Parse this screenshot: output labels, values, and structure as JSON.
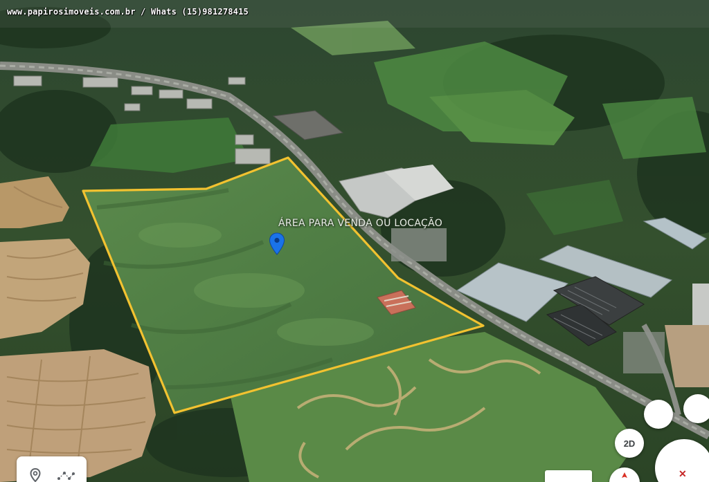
{
  "watermark": {
    "text": "www.papirosimoveis.com.br / Whats (15)981278415"
  },
  "map": {
    "area_label": "ÁREA PARA VENDA OU LOCAÇÃO",
    "boundary_color": "#f2c230",
    "pin_color": "#1a73e8",
    "pin_icon": "location-pin-icon"
  },
  "controls": {
    "view_mode_label": "2D",
    "measure_tool_icon": "location-marker-icon",
    "path_tool_icon": "route-icon",
    "compass_icon": "compass-icon",
    "zoom_icon": "close-icon"
  }
}
